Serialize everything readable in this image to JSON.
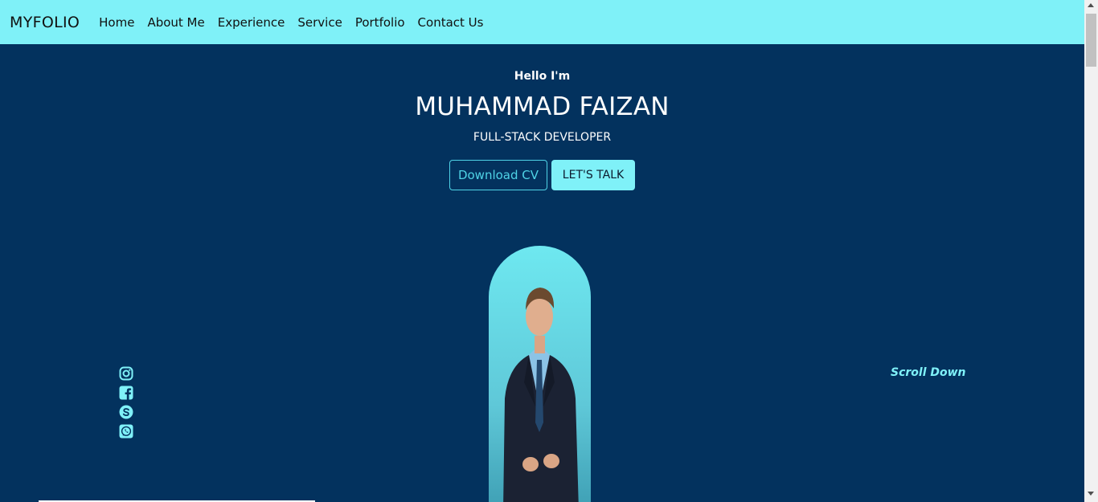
{
  "navbar": {
    "brand": "MYFOLIO",
    "links": [
      "Home",
      "About Me",
      "Experience",
      "Service",
      "Portfolio",
      "Contact Us"
    ]
  },
  "hero": {
    "greeting": "Hello I'm",
    "name": "MUHAMMAD FAIZAN",
    "role": "FULL-STACK DEVELOPER",
    "download_cv": "Download CV",
    "lets_talk": "LET'S TALK",
    "scroll_down": "Scroll Down"
  },
  "socials": [
    {
      "icon": "instagram-icon"
    },
    {
      "icon": "facebook-icon"
    },
    {
      "icon": "skype-icon"
    },
    {
      "icon": "whatsapp-icon"
    }
  ],
  "colors": {
    "background": "#03325e",
    "accent": "#7ff1f8",
    "outline_accent": "#4fd3e6"
  }
}
